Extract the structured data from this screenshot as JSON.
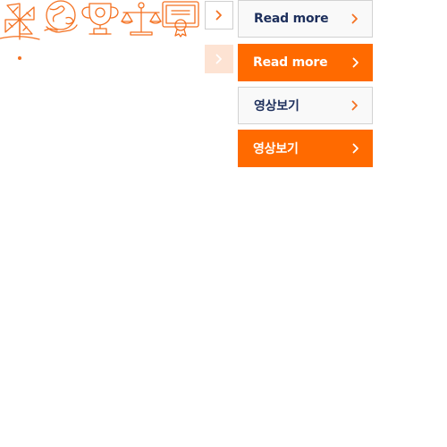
{
  "colors": {
    "accent": "#ff6a00",
    "icon_stroke": "#f47121",
    "faded_button": "#fde3d3",
    "label_dark": "#1d2f5c",
    "border": "#d2d2d2"
  },
  "icon_strip": {
    "icons": [
      "pinwheel-icon",
      "globe-hand-icon",
      "trophy-icon",
      "scales-icon",
      "certificate-icon"
    ]
  },
  "small_buttons": [
    {
      "style": "outlined",
      "icon": "chevron-right-icon",
      "color": "#f47121"
    },
    {
      "style": "faded",
      "icon": "chevron-right-icon",
      "color": "#ffffff"
    }
  ],
  "buttons": [
    {
      "label": "Read more",
      "style": "white",
      "icon": "chevron-right-icon"
    },
    {
      "label": "Read more",
      "style": "orange",
      "icon": "chevron-right-icon"
    },
    {
      "label": "영상보기",
      "style": "white",
      "icon": "chevron-right-icon"
    },
    {
      "label": "영상보기",
      "style": "orange",
      "icon": "chevron-right-icon"
    }
  ]
}
